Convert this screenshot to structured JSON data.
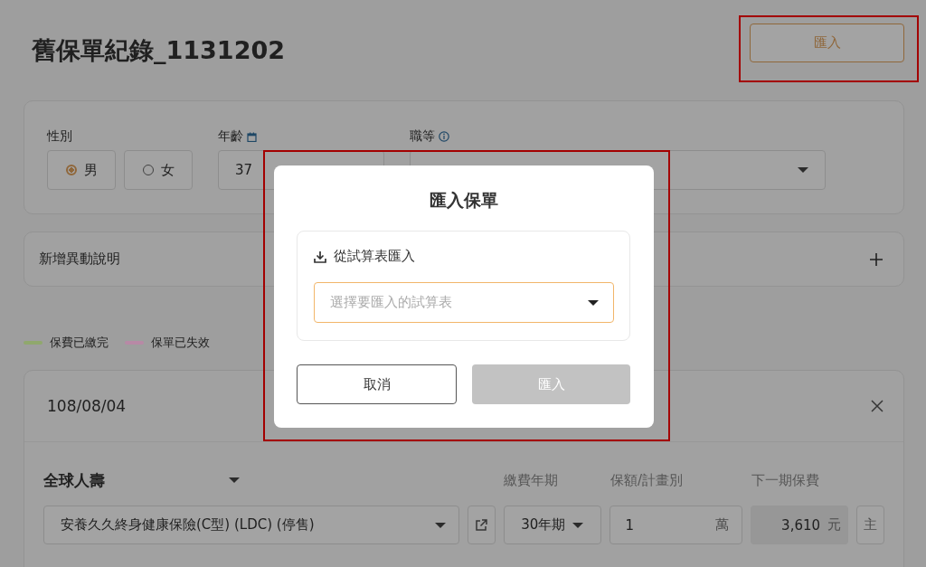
{
  "page": {
    "title": "舊保單紀錄_1131202",
    "import_button": "匯入"
  },
  "profile": {
    "gender": {
      "label": "性別",
      "options": [
        {
          "label": "男",
          "selected": true
        },
        {
          "label": "女",
          "selected": false
        }
      ]
    },
    "age": {
      "label": "年齡",
      "value": "37"
    },
    "job": {
      "label": "職等"
    }
  },
  "change_note": {
    "label": "新增異動說明"
  },
  "legend": [
    {
      "label": "保費已繳完",
      "color": "#90a86d"
    },
    {
      "label": "保單已失效",
      "color": "#b889a6"
    }
  ],
  "policy": {
    "date": "108/08/04",
    "insurer": "全球人壽",
    "columns": [
      "繳費年期",
      "保額/計畫別",
      "下一期保費"
    ],
    "rows": [
      {
        "product": "安養久久終身健康保險(C型) (LDC) (停售)",
        "term": "30年期",
        "amount": "1",
        "unit": "萬",
        "premium": "3,610",
        "currency": "元",
        "role": "主"
      }
    ]
  },
  "dialog": {
    "title": "匯入保單",
    "source_label": "從試算表匯入",
    "select_placeholder": "選擇要匯入的試算表",
    "buttons": [
      {
        "label": "取消",
        "kind": "secondary",
        "disabled": false
      },
      {
        "label": "匯入",
        "kind": "primary",
        "disabled": true
      }
    ]
  }
}
